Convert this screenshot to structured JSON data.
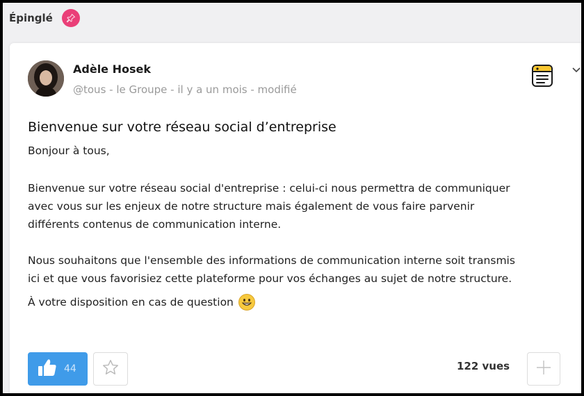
{
  "pinned": {
    "label": "Épinglé",
    "icon": "pin-icon",
    "badge_color": "#ea3f78"
  },
  "post": {
    "author": "Adèle Hosek",
    "meta": "@tous - le Groupe - il y a un mois  - modifié",
    "title": "Bienvenue sur votre réseau social d’entreprise",
    "greeting": "Bonjour à tous,",
    "paragraph1": [
      "Bienvenue sur votre réseau social d'entreprise : celui-ci nous permettra de communiquer",
      "avec vous sur les enjeux de notre structure mais également de vous faire parvenir",
      "différents contenus de communication interne."
    ],
    "paragraph2": [
      "Nous souhaitons que l'ensemble des informations de communication interne soit transmis",
      "ici et que vous favorisiez cette plateforme pour vos échanges au sujet de notre structure."
    ],
    "closing": "À votre disposition en cas de question",
    "closing_emoji": "grinning-face-emoji"
  },
  "actions": {
    "like_count": "44",
    "like_icon": "thumbs-up-icon",
    "like_color": "#3f9be9",
    "favorite_icon": "star-icon",
    "views": "122 vues",
    "add_icon": "plus-icon",
    "note_icon": "note-icon",
    "more_icon": "chevron-down-icon"
  }
}
